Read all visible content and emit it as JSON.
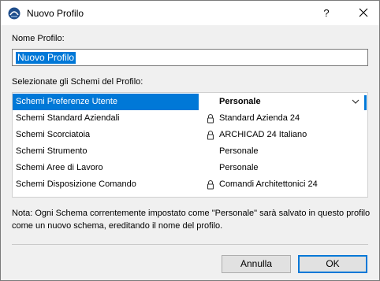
{
  "window": {
    "title": "Nuovo Profilo",
    "help_label": "?"
  },
  "form": {
    "name_label": "Nome Profilo:",
    "name_value": "Nuovo Profilo",
    "schemes_label": "Selezionate gli Schemi del Profilo:"
  },
  "schemes": [
    {
      "label": "Schemi Preferenze Utente",
      "value": "Personale",
      "locked": false,
      "selected": true
    },
    {
      "label": "Schemi Standard Aziendali",
      "value": "Standard Azienda 24",
      "locked": true,
      "selected": false
    },
    {
      "label": "Schemi Scorciatoia",
      "value": "ARCHICAD 24 Italiano",
      "locked": true,
      "selected": false
    },
    {
      "label": "Schemi Strumento",
      "value": "Personale",
      "locked": false,
      "selected": false
    },
    {
      "label": "Schemi Aree di Lavoro",
      "value": "Personale",
      "locked": false,
      "selected": false
    },
    {
      "label": "Schemi Disposizione Comando",
      "value": "Comandi Architettonici 24",
      "locked": true,
      "selected": false
    }
  ],
  "note": "Nota: Ogni Schema correntemente impostato come \"Personale\" sarà salvato in questo profilo come un nuovo schema, ereditando il nome del profilo.",
  "buttons": {
    "cancel": "Annulla",
    "ok": "OK"
  },
  "colors": {
    "accent": "#0078d7",
    "dialog_bg": "#f0f0f0"
  }
}
